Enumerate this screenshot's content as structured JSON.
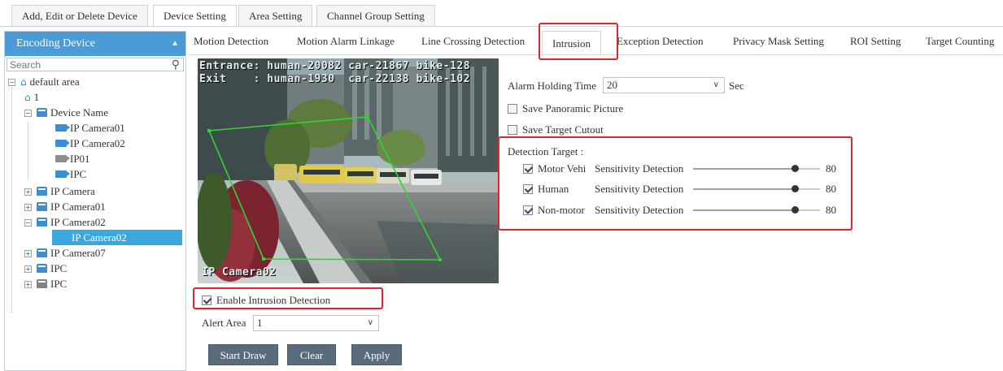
{
  "top_tabs": [
    {
      "label": "Add, Edit or Delete Device",
      "active": false
    },
    {
      "label": "Device Setting",
      "active": true
    },
    {
      "label": "Area Setting",
      "active": false
    },
    {
      "label": "Channel Group Setting",
      "active": false
    }
  ],
  "sidebar": {
    "title": "Encoding Device",
    "search_placeholder": "Search",
    "tree": [
      {
        "label": "default area",
        "icon": "home-icon"
      },
      {
        "label": "1",
        "icon": "home-icon"
      },
      {
        "label": "Device Name",
        "icon": "device-icon"
      },
      {
        "label": "IP Camera01",
        "icon": "camera-icon"
      },
      {
        "label": "IP Camera02",
        "icon": "camera-icon"
      },
      {
        "label": "IP01",
        "icon": "camera-offline-icon"
      },
      {
        "label": "IPC",
        "icon": "camera-icon"
      },
      {
        "label": "IP Camera",
        "icon": "device-icon"
      },
      {
        "label": "IP Camera01",
        "icon": "device-icon"
      },
      {
        "label": "IP Camera02",
        "icon": "device-icon"
      },
      {
        "label": "IP Camera02",
        "icon": "none",
        "selected": true
      },
      {
        "label": "IP Camera07",
        "icon": "device-icon"
      },
      {
        "label": "IPC",
        "icon": "device-icon"
      },
      {
        "label": "IPC",
        "icon": "device-offline-icon"
      }
    ]
  },
  "sub_tabs": [
    {
      "label": "Motion Detection"
    },
    {
      "label": "Motion Alarm Linkage"
    },
    {
      "label": "Line Crossing Detection"
    },
    {
      "label": "Intrusion",
      "active": true
    },
    {
      "label": "Exception Detection"
    },
    {
      "label": "Privacy Mask Setting"
    },
    {
      "label": "ROI Setting"
    },
    {
      "label": "Target Counting"
    }
  ],
  "video": {
    "osd_line1": "Entrance: human-20082 car-21867 bike-128",
    "osd_line2": "Exit    : human-1930  car-22138 bike-102",
    "camera_name": "IP Camera02"
  },
  "intrusion": {
    "enable_label": "Enable Intrusion Detection",
    "enable_checked": true,
    "alert_area_label": "Alert Area",
    "alert_area_value": "1",
    "start_draw": "Start Draw",
    "clear": "Clear",
    "apply": "Apply"
  },
  "settings": {
    "alarm_holding_label": "Alarm Holding Time",
    "alarm_holding_value": "20",
    "alarm_holding_unit": "Sec",
    "save_panoramic": "Save Panoramic Picture",
    "save_panoramic_checked": false,
    "save_cutout": "Save Target Cutout",
    "save_cutout_checked": false,
    "detection_target_label": "Detection Target :",
    "targets": [
      {
        "name": "Motor Vehi",
        "checked": true,
        "sens_label": "Sensitivity Detection",
        "value": "80",
        "level": 0.8
      },
      {
        "name": "Human",
        "checked": true,
        "sens_label": "Sensitivity Detection",
        "value": "80",
        "level": 0.8
      },
      {
        "name": "Non-motor",
        "checked": true,
        "sens_label": "Sensitivity Detection",
        "value": "80",
        "level": 0.8
      }
    ]
  },
  "colors": {
    "accent": "#4a9bd6",
    "selected": "#3aa8df",
    "highlight": "#e0262b",
    "zone": "#2fd62f",
    "button": "#5a6b7c"
  }
}
